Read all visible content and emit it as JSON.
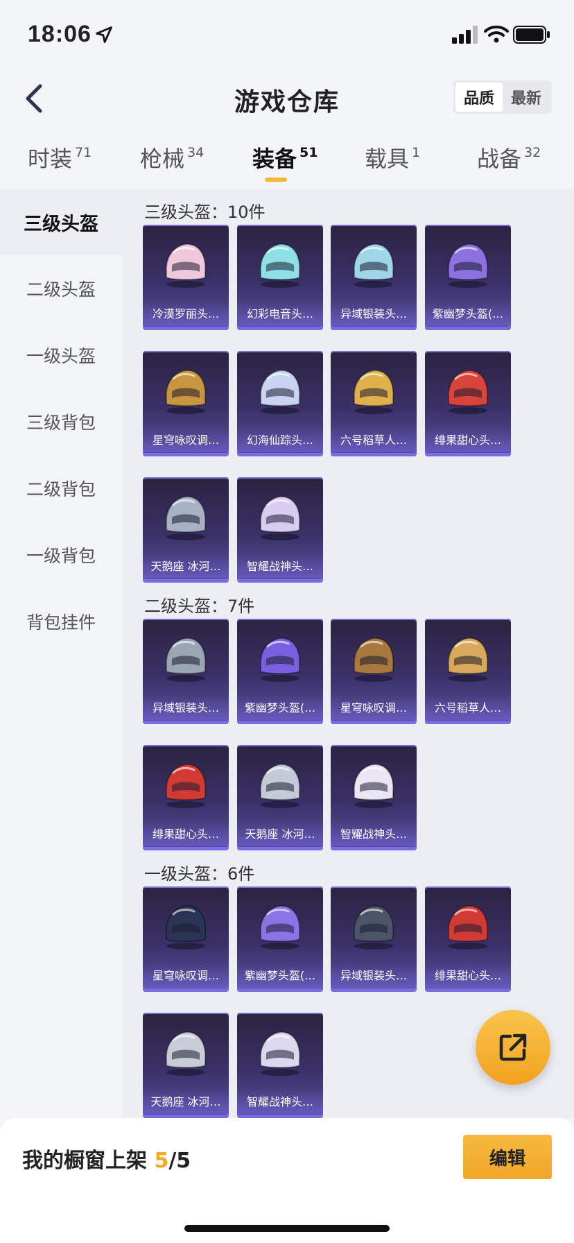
{
  "status": {
    "time": "18:06"
  },
  "header": {
    "title": "游戏仓库",
    "sort": [
      "品质",
      "最新"
    ]
  },
  "tabs": [
    {
      "label": "时装",
      "count": "71"
    },
    {
      "label": "枪械",
      "count": "34"
    },
    {
      "label": "装备",
      "count": "51"
    },
    {
      "label": "载具",
      "count": "1"
    },
    {
      "label": "战备",
      "count": "32"
    }
  ],
  "sidebar": [
    "三级头盔",
    "二级头盔",
    "一级头盔",
    "三级背包",
    "二级背包",
    "一级背包",
    "背包挂件"
  ],
  "sections": [
    {
      "title": "三级头盔：10件",
      "items": [
        {
          "label": "冷漠罗丽头…",
          "color": "#f0c8dc"
        },
        {
          "label": "幻彩电音头…",
          "color": "#8fe0e6"
        },
        {
          "label": "异域银装头…",
          "color": "#9fd6e8"
        },
        {
          "label": "紫幽梦头盔(…",
          "color": "#8b72e0"
        },
        {
          "label": "星穹咏叹调…",
          "color": "#c7963e"
        },
        {
          "label": "幻海仙踪头…",
          "color": "#c9d4f0"
        },
        {
          "label": "六号稻草人…",
          "color": "#e0b04a"
        },
        {
          "label": "绯果甜心头…",
          "color": "#d8433a"
        },
        {
          "label": "天鹅座 冰河…",
          "color": "#a7b2c4"
        },
        {
          "label": "智耀战神头…",
          "color": "#d8ccf0"
        }
      ]
    },
    {
      "title": "二级头盔：7件",
      "items": [
        {
          "label": "异域银装头…",
          "color": "#9aa6b4"
        },
        {
          "label": "紫幽梦头盔(…",
          "color": "#7a5fe0"
        },
        {
          "label": "星穹咏叹调…",
          "color": "#a9783e"
        },
        {
          "label": "六号稻草人…",
          "color": "#d8a95a"
        },
        {
          "label": "绯果甜心头…",
          "color": "#d23a34"
        },
        {
          "label": "天鹅座 冰河…",
          "color": "#c4cbd6"
        },
        {
          "label": "智耀战神头…",
          "color": "#eae6f4"
        }
      ]
    },
    {
      "title": "一级头盔：6件",
      "items": [
        {
          "label": "星穹咏叹调…",
          "color": "#2a3454"
        },
        {
          "label": "紫幽梦头盔(…",
          "color": "#8a74e6"
        },
        {
          "label": "异域银装头…",
          "color": "#4b5566"
        },
        {
          "label": "绯果甜心头…",
          "color": "#d23a34"
        },
        {
          "label": "天鹅座 冰河…",
          "color": "#c8ccd6"
        },
        {
          "label": "智耀战神头…",
          "color": "#dcd8f0"
        }
      ]
    }
  ],
  "bottom": {
    "shelf_label": "我的橱窗上架",
    "shelf_current": "5",
    "shelf_total": "/5",
    "edit_label": "编辑"
  }
}
